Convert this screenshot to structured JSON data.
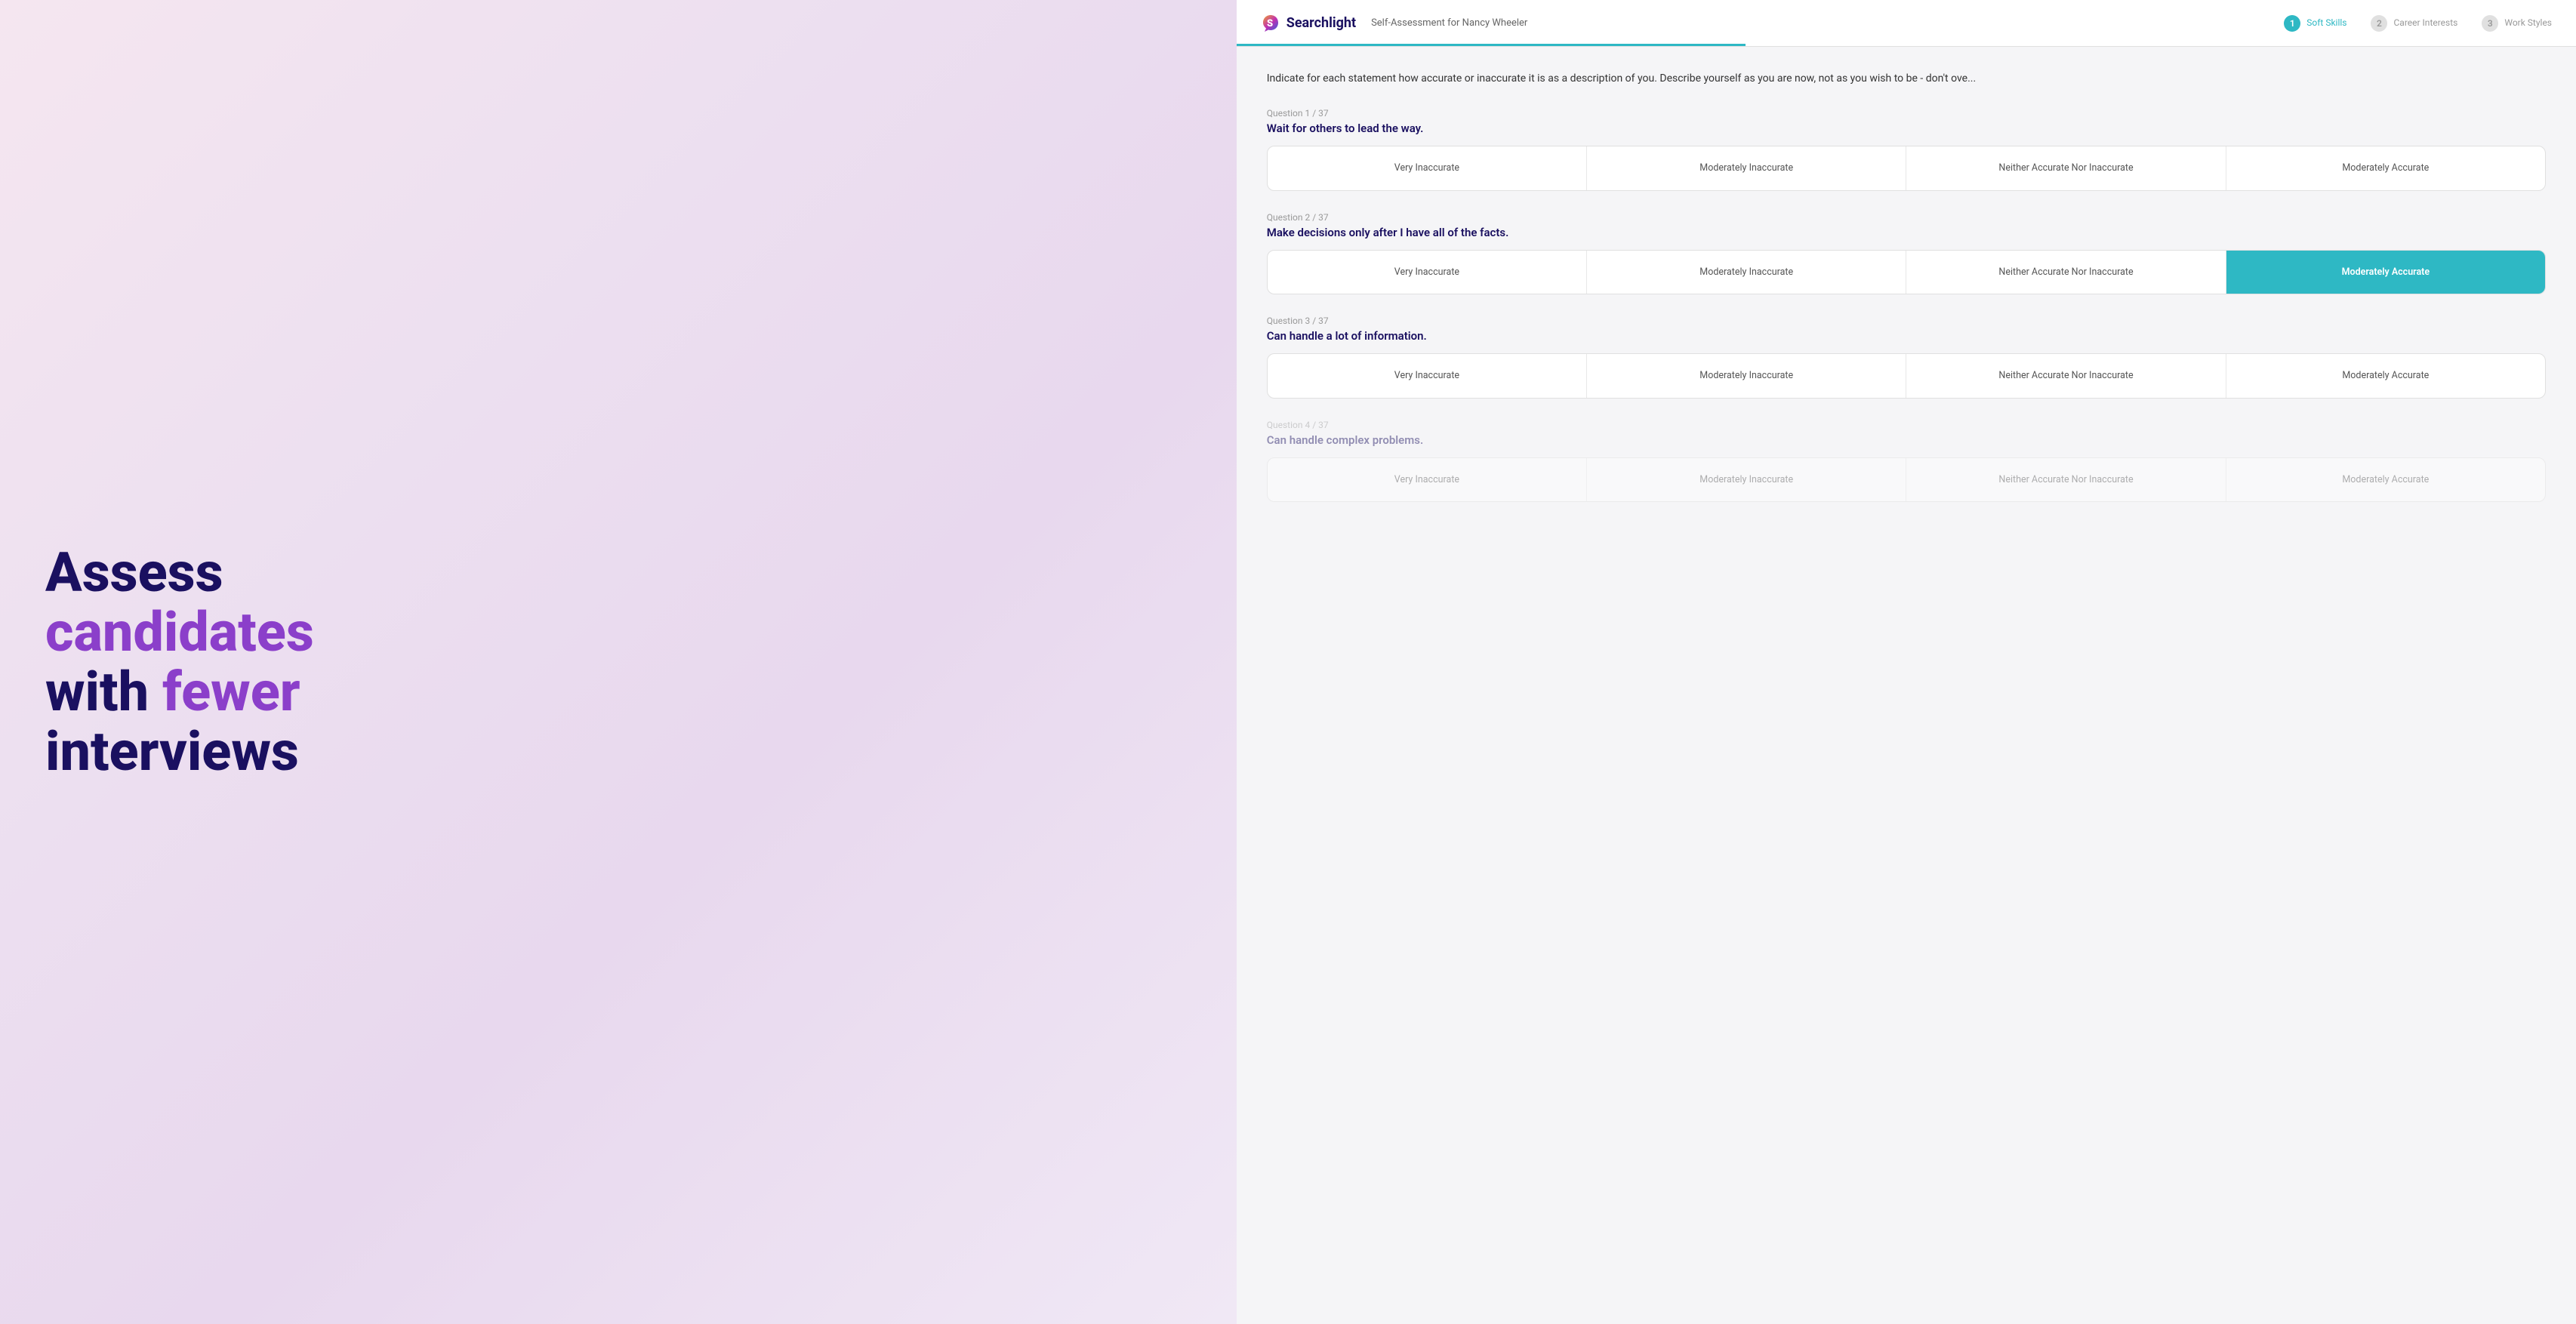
{
  "hero": {
    "line1": "Assess",
    "line2_purple": "candidates",
    "line3": "with",
    "line3_purple": "fewer",
    "line4": "interviews"
  },
  "header": {
    "logo_text": "Searchlight",
    "subtitle": "Self-Assessment for Nancy Wheeler",
    "steps": [
      {
        "num": "1",
        "label": "Soft Skills",
        "active": true
      },
      {
        "num": "2",
        "label": "Career\nInterests",
        "active": false
      },
      {
        "num": "3",
        "label": "Work Styles",
        "active": false
      }
    ]
  },
  "instruction": "Indicate for each statement how accurate or inaccurate it is as a description of you. Describe yourself as you are now, not as you wish to be - don't ove...",
  "questions": [
    {
      "label": "Question 1 / 37",
      "text": "Wait for others to lead the way.",
      "options": [
        "Very Inaccurate",
        "Moderately Inaccurate",
        "Neither Accurate Nor Inaccurate",
        "Moderately Accurate"
      ],
      "selected": null
    },
    {
      "label": "Question 2 / 37",
      "text": "Make decisions only after I have all of the facts.",
      "options": [
        "Very Inaccurate",
        "Moderately Inaccurate",
        "Neither Accurate Nor Inaccurate",
        "Moderately Accurate"
      ],
      "selected": 3
    },
    {
      "label": "Question 3 / 37",
      "text": "Can handle a lot of information.",
      "options": [
        "Very Inaccurate",
        "Moderately Inaccurate",
        "Neither Accurate Nor Inaccurate",
        "Moderately Accurate"
      ],
      "selected": null
    },
    {
      "label": "Question 4 / 37",
      "text": "Can handle complex problems.",
      "options": [
        "Very Inaccurate",
        "Moderately Inaccurate",
        "Neither Accurate Nor Inaccurate",
        "Moderately Accurate"
      ],
      "selected": null,
      "faded": true
    }
  ]
}
